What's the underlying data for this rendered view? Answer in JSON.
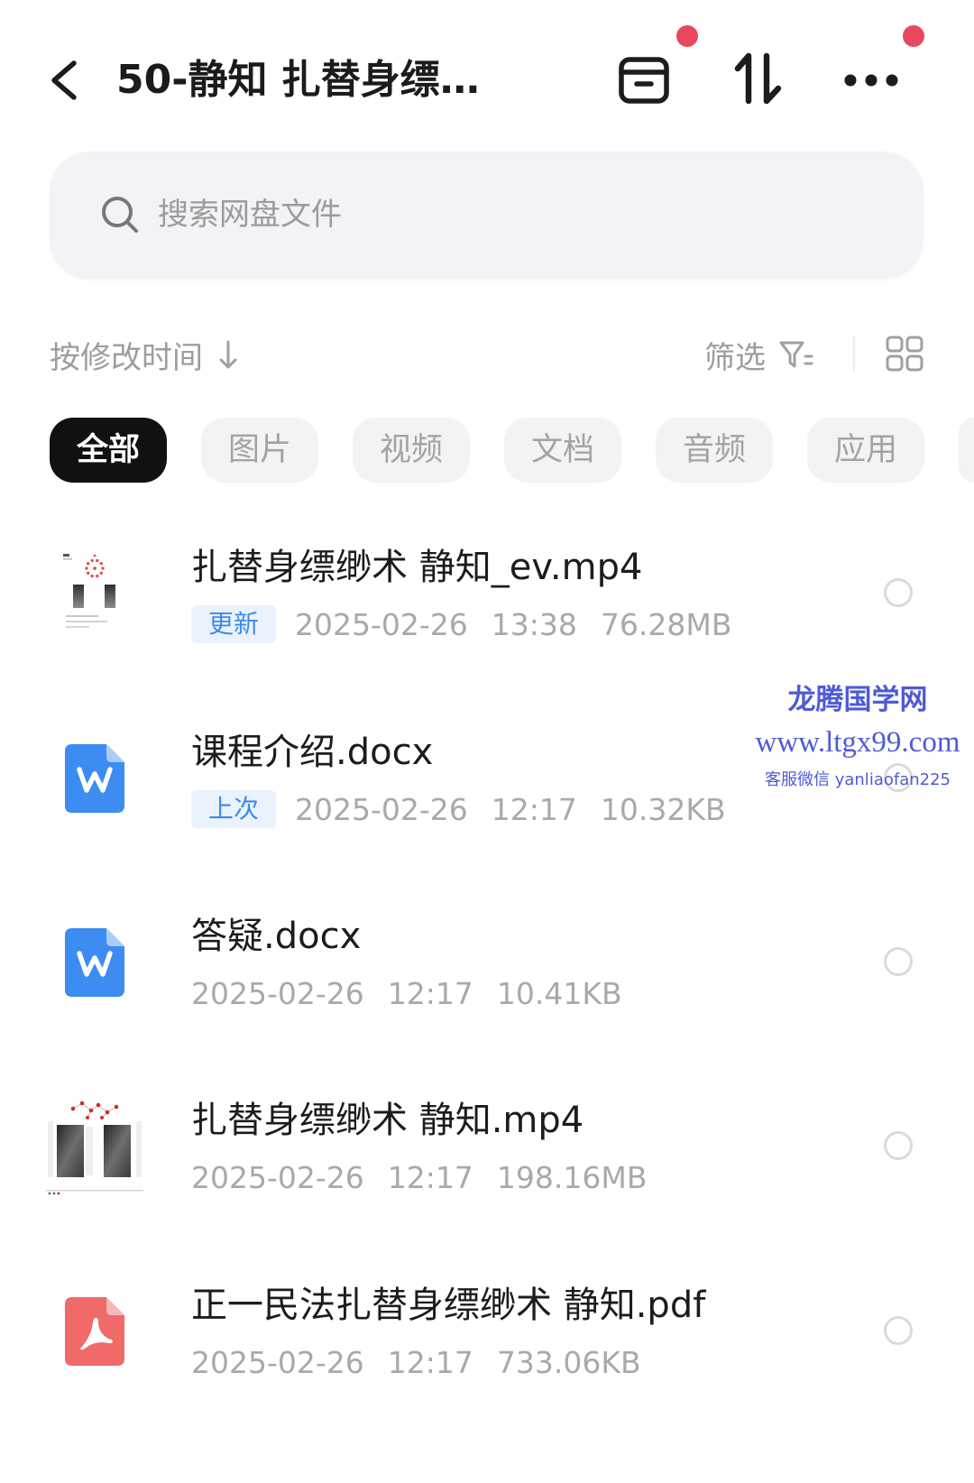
{
  "header": {
    "title": "50-静知 扎替身缥…",
    "back_icon": "back-chevron-icon",
    "actions": [
      {
        "icon": "archive-box-icon",
        "has_notification_dot": true
      },
      {
        "icon": "sort-arrows-icon",
        "has_notification_dot": false
      },
      {
        "icon": "more-dots-icon",
        "has_notification_dot": true
      }
    ]
  },
  "search": {
    "placeholder": "搜索网盘文件",
    "icon": "search-icon"
  },
  "toolbar": {
    "sort_label": "按修改时间",
    "sort_icon": "arrow-down-icon",
    "filter_label": "筛选",
    "filter_icon": "filter-icon",
    "view_icon": "grid-view-icon"
  },
  "tabs": [
    {
      "label": "全部",
      "active": true
    },
    {
      "label": "图片",
      "active": false
    },
    {
      "label": "视频",
      "active": false
    },
    {
      "label": "文档",
      "active": false
    },
    {
      "label": "音频",
      "active": false
    },
    {
      "label": "应用",
      "active": false
    }
  ],
  "files": [
    {
      "icon": "video-thumbnail-icon",
      "name": "扎替身缥缈术 静知_ev.mp4",
      "badge": "更新",
      "date": "2025-02-26",
      "time": "13:38",
      "size": "76.28MB",
      "selected": false
    },
    {
      "icon": "word-doc-icon",
      "name": "课程介绍.docx",
      "badge": "上次",
      "date": "2025-02-26",
      "time": "12:17",
      "size": "10.32KB",
      "selected": false
    },
    {
      "icon": "word-doc-icon",
      "name": "答疑.docx",
      "date": "2025-02-26",
      "time": "12:17",
      "size": "10.41KB",
      "selected": false
    },
    {
      "icon": "video-thumbnail-icon",
      "name": "扎替身缥缈术 静知.mp4",
      "date": "2025-02-26",
      "time": "12:17",
      "size": "198.16MB",
      "selected": false
    },
    {
      "icon": "pdf-icon",
      "name": "正一民法扎替身缥缈术 静知.pdf",
      "date": "2025-02-26",
      "time": "12:17",
      "size": "733.06KB",
      "selected": false
    }
  ],
  "watermark": {
    "site_name": "龙腾国学网",
    "url": "www.ltgx99.com",
    "contact": "客服微信 yanliaofan225"
  },
  "colors": {
    "active_tab_bg": "#111114",
    "notification_dot": "#e8475e",
    "badge_bg": "#eaf3fd",
    "badge_text": "#3d8aea",
    "word_icon": "#3c8cf1",
    "pdf_icon": "#f06a6a",
    "watermark": "#4f5bd5"
  }
}
